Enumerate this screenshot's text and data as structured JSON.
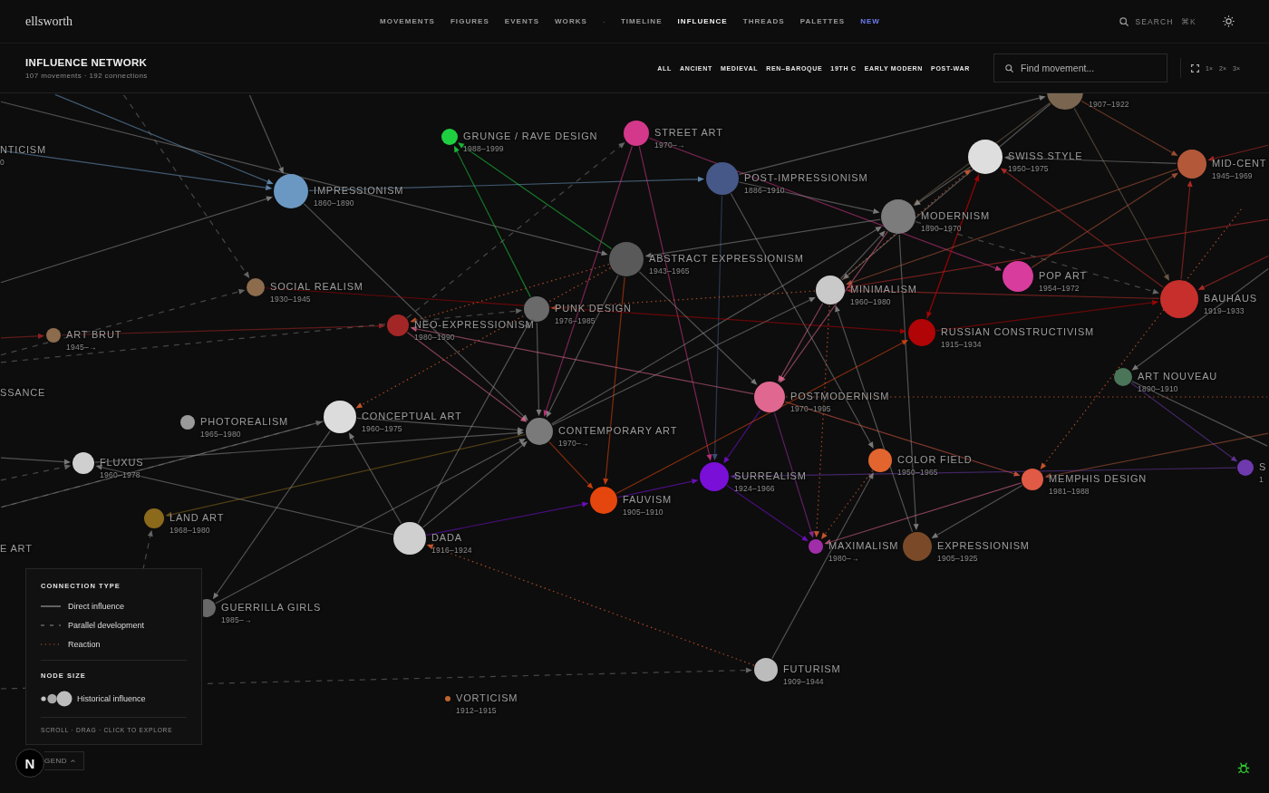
{
  "header": {
    "brand": "ellsworth",
    "nav": [
      {
        "label": "MOVEMENTS",
        "kind": "link",
        "selected": false
      },
      {
        "label": "FIGURES",
        "kind": "link",
        "selected": false
      },
      {
        "label": "EVENTS",
        "kind": "link",
        "selected": false
      },
      {
        "label": "WORKS",
        "kind": "link",
        "selected": false
      },
      {
        "label": "·",
        "kind": "separator"
      },
      {
        "label": "TIMELINE",
        "kind": "link",
        "selected": false
      },
      {
        "label": "INFLUENCE",
        "kind": "link",
        "selected": true
      },
      {
        "label": "THREADS",
        "kind": "link",
        "selected": false
      },
      {
        "label": "PALETTES",
        "kind": "link",
        "selected": false
      },
      {
        "label": "NEW",
        "kind": "new",
        "selected": false
      }
    ],
    "search": {
      "label": "SEARCH",
      "shortcut": "⌘K"
    }
  },
  "toolbar": {
    "title": "INFLUENCE NETWORK",
    "subtitle": "107 movements · 192 connections",
    "filters": [
      "ALL",
      "ANCIENT",
      "MEDIEVAL",
      "REN–BAROQUE",
      "19TH C",
      "EARLY MODERN",
      "POST-WAR"
    ],
    "search": {
      "placeholder": "Find movement..."
    },
    "zoom_levels": [
      "1×",
      "2×",
      "3×"
    ]
  },
  "movements": [
    {
      "dates": "1907–1922",
      "color": "#7a6650"
    },
    {
      "label": "GRUNGE / RAVE DESIGN",
      "dates": "1988–1999",
      "color": "#1ed040"
    },
    {
      "label": "STREET ART",
      "dates": "1970–→",
      "color": "#d4388a"
    },
    {
      "label": "NTICISM",
      "dates": "0"
    },
    {
      "label": "SWISS STYLE",
      "dates": "1950–1975",
      "color": "#dedede"
    },
    {
      "label": "MID-CENT",
      "dates": "1945–1969",
      "color": "#b4583a"
    },
    {
      "label": "IMPRESSIONISM",
      "dates": "1860–1890",
      "color": "#6b98c2"
    },
    {
      "label": "POST-IMPRESSIONISM",
      "dates": "1886–1910",
      "color": "#465888"
    },
    {
      "label": "MODERNISM",
      "dates": "1890–1970",
      "color": "#7c7c7c"
    },
    {
      "label": "ABSTRACT EXPRESSIONISM",
      "dates": "1943–1965",
      "color": "#595959"
    },
    {
      "label": "POP ART",
      "dates": "1954–1972",
      "color": "#d83c9c"
    },
    {
      "label": "SOCIAL REALISM",
      "dates": "1930–1945",
      "color": "#8c6c4c"
    },
    {
      "label": "MINIMALISM",
      "dates": "1960–1980",
      "color": "#c9c9c9"
    },
    {
      "label": "BAUHAUS",
      "dates": "1919–1933",
      "color": "#c62f2b"
    },
    {
      "label": "PUNK DESIGN",
      "dates": "1976–1985",
      "color": "#6a6a6a"
    },
    {
      "label": "NEO-EXPRESSIONISM",
      "dates": "1980–1990",
      "color": "#a32626"
    },
    {
      "label": "ART BRUT",
      "dates": "1945–→",
      "color": "#8c6c4c"
    },
    {
      "label": "RUSSIAN CONSTRUCTIVISM",
      "dates": "1915–1934",
      "color": "#b00406"
    },
    {
      "label": "ART NOUVEAU",
      "dates": "1890–1910",
      "color": "#4a7558"
    },
    {
      "label": "SSANCE"
    },
    {
      "label": "POSTMODERNISM",
      "dates": "1970–1995",
      "color": "#e06890"
    },
    {
      "label": "PHOTOREALISM",
      "dates": "1965–1980",
      "color": "#9a9a9a"
    },
    {
      "label": "CONCEPTUAL ART",
      "dates": "1960–1975",
      "color": "#dcdcdc"
    },
    {
      "label": "CONTEMPORARY ART",
      "dates": "1970–→",
      "color": "#7a7a7a"
    },
    {
      "label": "FLUXUS",
      "dates": "1960–1978",
      "color": "#cfcfcf"
    },
    {
      "label": "COLOR FIELD",
      "dates": "1950–1965",
      "color": "#e2652f"
    },
    {
      "label": "SURREALISM",
      "dates": "1924–1966",
      "color": "#7a0fd8"
    },
    {
      "label": "MEMPHIS DESIGN",
      "dates": "1981–1988",
      "color": "#e05a45"
    },
    {
      "label": "S",
      "dates": "1",
      "color": "#6e3aae"
    },
    {
      "label": "FAUVISM",
      "dates": "1905–1910",
      "color": "#e4460e"
    },
    {
      "label": "LAND ART",
      "dates": "1968–1980",
      "color": "#8c6a1c"
    },
    {
      "label": "E ART"
    },
    {
      "label": "DADA",
      "dates": "1916–1924",
      "color": "#cfcfcf"
    },
    {
      "label": "MAXIMALISM",
      "dates": "1980–→",
      "color": "#a02ea8"
    },
    {
      "label": "EXPRESSIONISM",
      "dates": "1905–1925",
      "color": "#7a4a28"
    },
    {
      "label": "GUERRILLA GIRLS",
      "dates": "1985–→",
      "color": "#686868"
    },
    {
      "label": "FUTURISM",
      "dates": "1909–1944",
      "color": "#bcbcbc"
    },
    {
      "label": "VORTICISM",
      "dates": "1912–1915",
      "color": "#c0652e"
    }
  ],
  "legend": {
    "connection_heading": "CONNECTION TYPE",
    "connection_types": [
      {
        "kind": "direct",
        "label": "Direct influence"
      },
      {
        "kind": "parallel",
        "label": "Parallel development"
      },
      {
        "kind": "reaction",
        "label": "Reaction"
      }
    ],
    "size_heading": "NODE SIZE",
    "size_label": "Historical influence",
    "hint": "SCROLL · DRAG · CLICK TO EXPLORE"
  },
  "legend_toggle": {
    "label": "GEND"
  },
  "dev_badge": "N"
}
